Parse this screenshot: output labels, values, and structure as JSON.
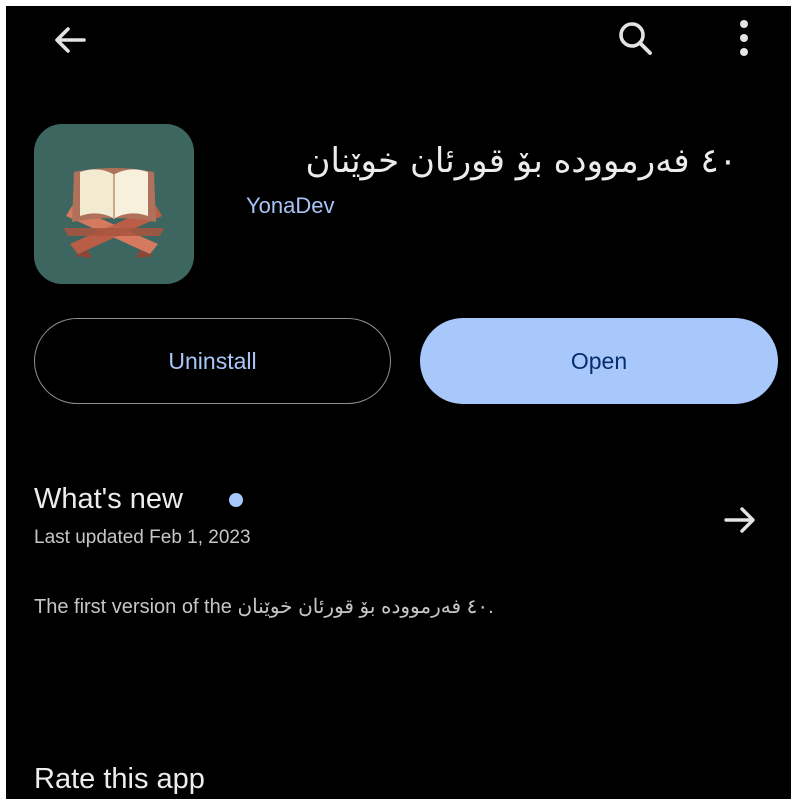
{
  "top_bar": {
    "back_icon": "arrow-left",
    "search_icon": "search",
    "more_icon": "more-vertical"
  },
  "app": {
    "title": "٤٠ فەرمووده بۆ قورئان خوێنان",
    "developer": "YonaDev",
    "icon": "quran-on-stand",
    "icon_bg_color": "#3d6660"
  },
  "actions": {
    "uninstall_label": "Uninstall",
    "open_label": "Open"
  },
  "whats_new": {
    "title": "What's new",
    "last_updated": "Last updated Feb 1, 2023",
    "indicator_color": "#a8c7fa",
    "arrow_icon": "arrow-right"
  },
  "release_notes": {
    "prefix": "The first version of the",
    "app_name": "٤٠ فەرمووده بۆ قورئان خوێنان",
    "suffix": "."
  },
  "rate": {
    "title": "Rate this app"
  },
  "colors": {
    "background": "#000000",
    "accent": "#a8c7fa",
    "primary_text": "#ececec",
    "secondary_text": "#c4c7c5"
  }
}
